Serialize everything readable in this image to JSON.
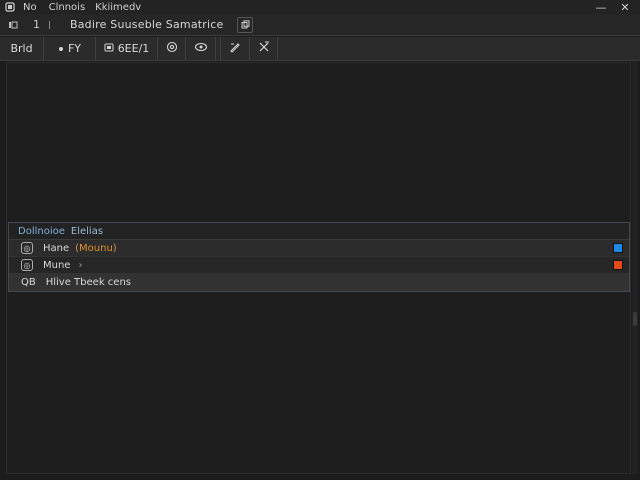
{
  "titlebar": {
    "title": "No",
    "menu1": "Clnnois",
    "menu2": "Kkiimedv",
    "minimize": "—",
    "close": "✕"
  },
  "tabrow": {
    "label": "1",
    "tab_name": "Badire  Suuseble  Samatrice",
    "icon": "copy-icon"
  },
  "toolbar": {
    "items": [
      {
        "label": "Brld",
        "icon": ""
      },
      {
        "label": "FY",
        "icon": "dot-icon"
      },
      {
        "label": "6EE/1",
        "icon": "rect-icon"
      },
      {
        "label": "",
        "icon": "at-icon"
      },
      {
        "label": "",
        "icon": "link-icon"
      },
      {
        "label": "",
        "icon": "edit-icon"
      },
      {
        "label": "",
        "icon": "cross-tool-icon"
      }
    ]
  },
  "panel": {
    "header": "Dollnoioe",
    "header_sub": "Elelias",
    "rows": [
      {
        "icon_glyph": "◎",
        "text": "Hane",
        "paren": "(Mounu)",
        "color": "#1e88e5"
      },
      {
        "icon_glyph": "◎",
        "text": "Mune",
        "arrow": "›",
        "color": "#e64a19"
      },
      {
        "code": "QB",
        "text": "Hlive  Tbeek  cens"
      }
    ]
  },
  "colors": {
    "accent_blue": "#1e88e5",
    "accent_red": "#e64a19",
    "panel_header_text": "#7fb0d8"
  }
}
